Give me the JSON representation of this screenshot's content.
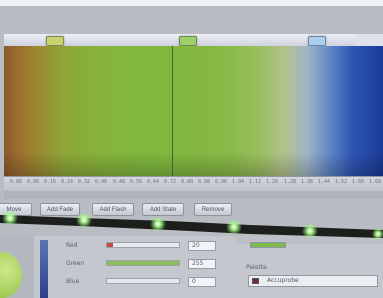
{
  "ruler": {
    "markers": [
      {
        "name": "stop-marker-1",
        "color": "#c9d470"
      },
      {
        "name": "stop-marker-2",
        "color": "#9fd06a"
      },
      {
        "name": "stop-marker-3",
        "color": "#aacdf2"
      }
    ],
    "tick_labels": [
      "0.00",
      "0.08",
      "0.16",
      "0.24",
      "0.32",
      "0.40",
      "0.48",
      "0.56",
      "0.64",
      "0.72",
      "0.80",
      "0.88",
      "0.96",
      "1.04",
      "1.12",
      "1.20",
      "1.28",
      "1.36",
      "1.44",
      "1.52",
      "1.60",
      "1.68"
    ]
  },
  "gradient": {
    "colors": [
      "#8a5a2f",
      "#86b43c",
      "#9cbf63",
      "#2e55b4",
      "#1b3b95"
    ]
  },
  "toolbar": {
    "buttons": [
      {
        "label": "Move"
      },
      {
        "label": "Add Fade"
      },
      {
        "label": "Add Flash"
      },
      {
        "label": "Add State"
      },
      {
        "label": "Remove"
      }
    ]
  },
  "channels": {
    "red": {
      "label": "Red",
      "value": "20",
      "level": 0.08,
      "color": "#c64a4a"
    },
    "green": {
      "label": "Green",
      "value": "255",
      "level": 1.0,
      "color": "#8dc05a"
    },
    "blue": {
      "label": "Blue",
      "value": "0",
      "level": 0.0,
      "color": "#4a6fc6"
    }
  },
  "palette": {
    "label": "Palette",
    "selected": "Accuprobe",
    "swatch_color": "#6b2a35"
  },
  "led_strip": {
    "led_color": "#9bff7a"
  }
}
